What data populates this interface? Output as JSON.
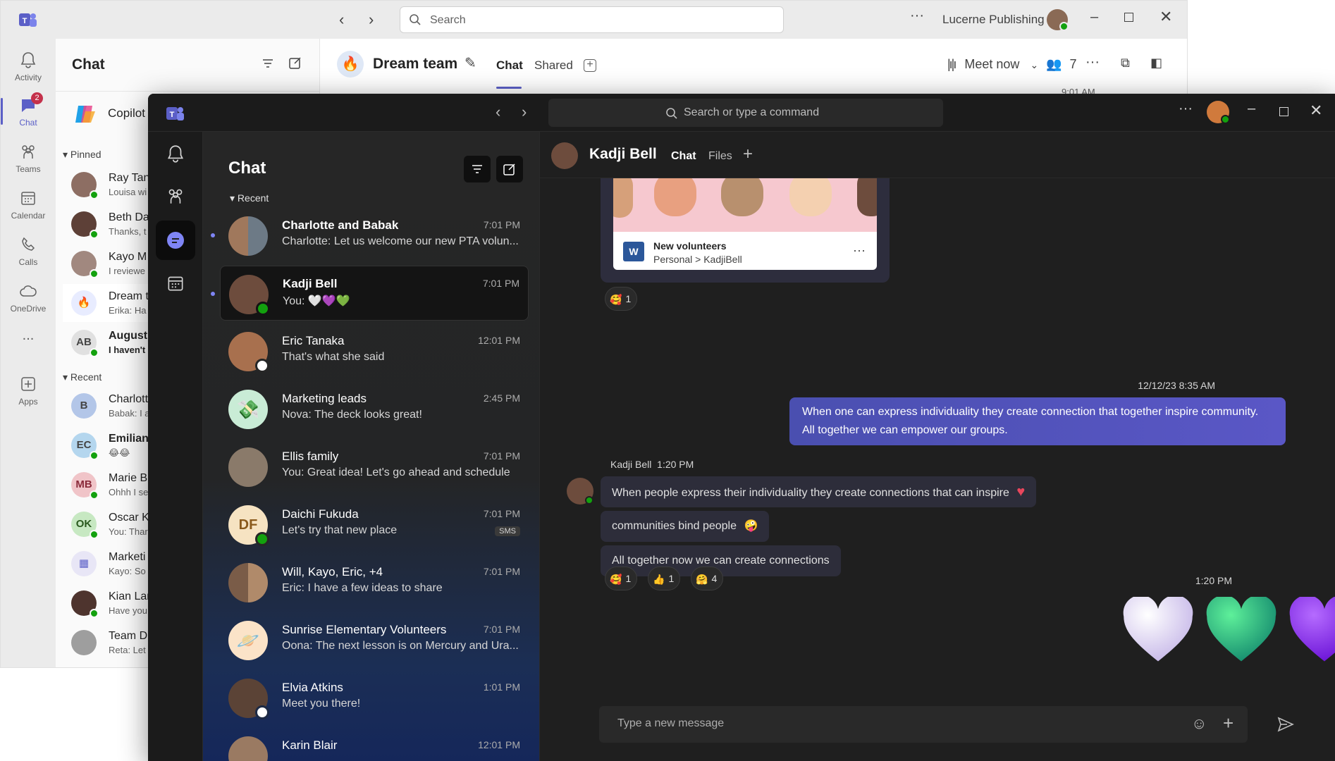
{
  "back_window": {
    "search": {
      "placeholder": "Search"
    },
    "org_name": "Lucerne Publishing",
    "rail": [
      {
        "label": "Activity",
        "icon": "bell-icon"
      },
      {
        "label": "Chat",
        "icon": "chat-icon",
        "badge": "2"
      },
      {
        "label": "Teams",
        "icon": "teams-icon"
      },
      {
        "label": "Calendar",
        "icon": "calendar-icon"
      },
      {
        "label": "Calls",
        "icon": "phone-icon"
      },
      {
        "label": "OneDrive",
        "icon": "cloud-icon"
      },
      {
        "label": "...",
        "icon": "more-icon"
      },
      {
        "label": "Apps",
        "icon": "add-app-icon"
      }
    ],
    "list_title": "Chat",
    "copilot_label": "Copilot",
    "pinned_label": "Pinned",
    "recent_label": "Recent",
    "pinned": [
      {
        "name": "Ray Tan",
        "preview": "Louisa wi"
      },
      {
        "name": "Beth Da",
        "preview": "Thanks, t"
      },
      {
        "name": "Kayo M",
        "preview": "I reviewe"
      },
      {
        "name": "Dream t",
        "preview": "Erika: Ha"
      },
      {
        "name": "August",
        "preview": "I haven't",
        "initials": "AB"
      }
    ],
    "recent": [
      {
        "name": "Charlott",
        "preview": "Babak: I a"
      },
      {
        "name": "Emilian",
        "preview": "😂😂",
        "initials": "EC"
      },
      {
        "name": "Marie B",
        "preview": "Ohhh I se",
        "initials": "MB"
      },
      {
        "name": "Oscar K",
        "preview": "You: Thar",
        "initials": "OK"
      },
      {
        "name": "Marketi",
        "preview": "Kayo: So"
      },
      {
        "name": "Kian Lar",
        "preview": "Have you"
      },
      {
        "name": "Team D",
        "preview": "Reta: Let"
      }
    ],
    "conversation": {
      "title": "Dream team",
      "tabs": [
        "Chat",
        "Shared"
      ],
      "meet_now": "Meet now",
      "participants": "7",
      "time_hint": "9:01 AM"
    }
  },
  "front_window": {
    "search": {
      "placeholder": "Search or type a command"
    },
    "list_title": "Chat",
    "recent_label": "Recent",
    "chats": [
      {
        "name": "Charlotte and Babak",
        "preview": "Charlotte: Let us welcome our new PTA volun...",
        "time": "7:01 PM",
        "unread": true
      },
      {
        "name": "Kadji Bell",
        "preview": "You: 🤍💜💚",
        "time": "7:01 PM",
        "unread": true,
        "selected": true
      },
      {
        "name": "Eric Tanaka",
        "preview": "That's what she said",
        "time": "12:01 PM"
      },
      {
        "name": "Marketing leads",
        "preview": "Nova: The deck looks great!",
        "time": "2:45 PM"
      },
      {
        "name": "Ellis family",
        "preview": "You: Great idea! Let's go ahead and schedule",
        "time": "7:01 PM"
      },
      {
        "name": "Daichi Fukuda",
        "preview": "Let's try that new place",
        "time": "7:01 PM",
        "badge": "SMS",
        "initials": "DF"
      },
      {
        "name": "Will, Kayo, Eric, +4",
        "preview": "Eric: I have a few ideas to share",
        "time": "7:01 PM"
      },
      {
        "name": "Sunrise Elementary Volunteers",
        "preview": "Oona: The next lesson is on Mercury and Ura...",
        "time": "7:01 PM"
      },
      {
        "name": "Elvia Atkins",
        "preview": "Meet you there!",
        "time": "1:01 PM"
      },
      {
        "name": "Karin Blair",
        "preview": "",
        "time": "12:01 PM"
      }
    ],
    "conversation": {
      "contact": "Kadji Bell",
      "tabs": [
        "Chat",
        "Files"
      ],
      "file_card": {
        "title": "New volunteers",
        "path": "Personal > KadjiBell"
      },
      "file_reaction_count": "1",
      "my_message_time": "12/12/23 8:35 AM",
      "my_message": "When one can express individuality they create connection that together inspire community. All together we can empower our groups.",
      "their_sender": "Kadji Bell",
      "their_time": "1:20 PM",
      "their_messages": [
        "When people express their individuality they create connections that can inspire",
        "communities bind people",
        "All together now we can create connections"
      ],
      "reactions": [
        {
          "icon": "heart-face-emoji-icon",
          "count": "1"
        },
        {
          "icon": "thumbs-up-emoji-icon",
          "count": "1"
        },
        {
          "icon": "hug-emoji-icon",
          "count": "4"
        }
      ],
      "hearts_time": "1:20 PM",
      "compose_placeholder": "Type a new message"
    }
  },
  "colors": {
    "accent": "#5b5fc7",
    "accent_light": "#7f85f5",
    "available": "#13a10e",
    "bubble_me": "#4f52b2",
    "dark_bg": "#1f1f1f"
  }
}
